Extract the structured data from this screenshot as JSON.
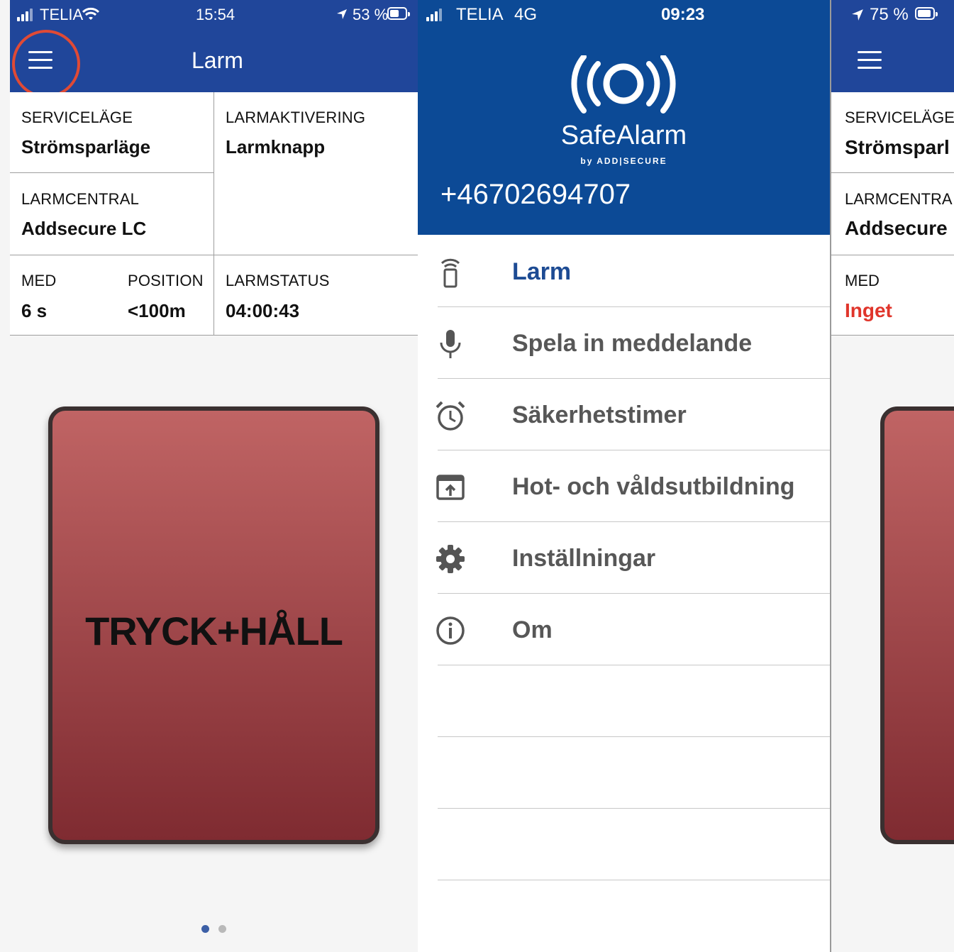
{
  "left_phone": {
    "status_bar": {
      "carrier": "TELIA",
      "time": "15:54",
      "battery_percent": "53 %"
    },
    "nav_title": "Larm",
    "serviceläge": {
      "label": "SERVICELÄGE",
      "value": "Strömsparläge"
    },
    "larmaktivering": {
      "label": "LARMAKTIVERING",
      "value": "Larmknapp"
    },
    "larmcentral": {
      "label": "LARMCENTRAL",
      "value": "Addsecure LC"
    },
    "med": {
      "label": "MED",
      "value": "6 s"
    },
    "position": {
      "label": "POSITION",
      "value": "<100m"
    },
    "larmstatus": {
      "label": "LARMSTATUS",
      "value": "04:00:43"
    },
    "alarm_button_label": "TRYCK+HÅLL",
    "page_dots": {
      "count": 2,
      "active_index": 0
    }
  },
  "menu_phone": {
    "status_bar": {
      "carrier": "TELIA",
      "network": "4G",
      "time": "09:23"
    },
    "brand_logo_icon": "broadcast-icon",
    "brand_name": "SafeAlarm",
    "brand_byline": "by ADD|SECURE",
    "phone_number": "+46702694707",
    "items": [
      {
        "label": "Larm",
        "icon": "remote-icon",
        "active": true
      },
      {
        "label": "Spela in meddelande",
        "icon": "microphone-icon",
        "active": false
      },
      {
        "label": "Säkerhetstimer",
        "icon": "alarm-clock-icon",
        "active": false
      },
      {
        "label": "Hot- och våldsutbildning",
        "icon": "open-external-icon",
        "active": false
      },
      {
        "label": "Inställningar",
        "icon": "gear-icon",
        "active": false
      },
      {
        "label": "Om",
        "icon": "info-icon",
        "active": false
      }
    ]
  },
  "right_phone": {
    "status_bar": {
      "battery_percent": "75 %"
    },
    "serviceläge": {
      "label": "SERVICELÄGE",
      "value": "Strömsparl"
    },
    "larmcentral": {
      "label": "LARMCENTRA",
      "value": "Addsecure"
    },
    "med": {
      "label": "MED",
      "value": "Inget"
    }
  },
  "colors": {
    "nav_blue": "#20469a",
    "menu_header_blue": "#0c4a96",
    "active_menu_text": "#1d4b93",
    "alarm_red_top": "#c06464",
    "alarm_red_bottom": "#7f2b31",
    "highlight_circle": "#e04a35",
    "warning_red": "#e0352b"
  }
}
